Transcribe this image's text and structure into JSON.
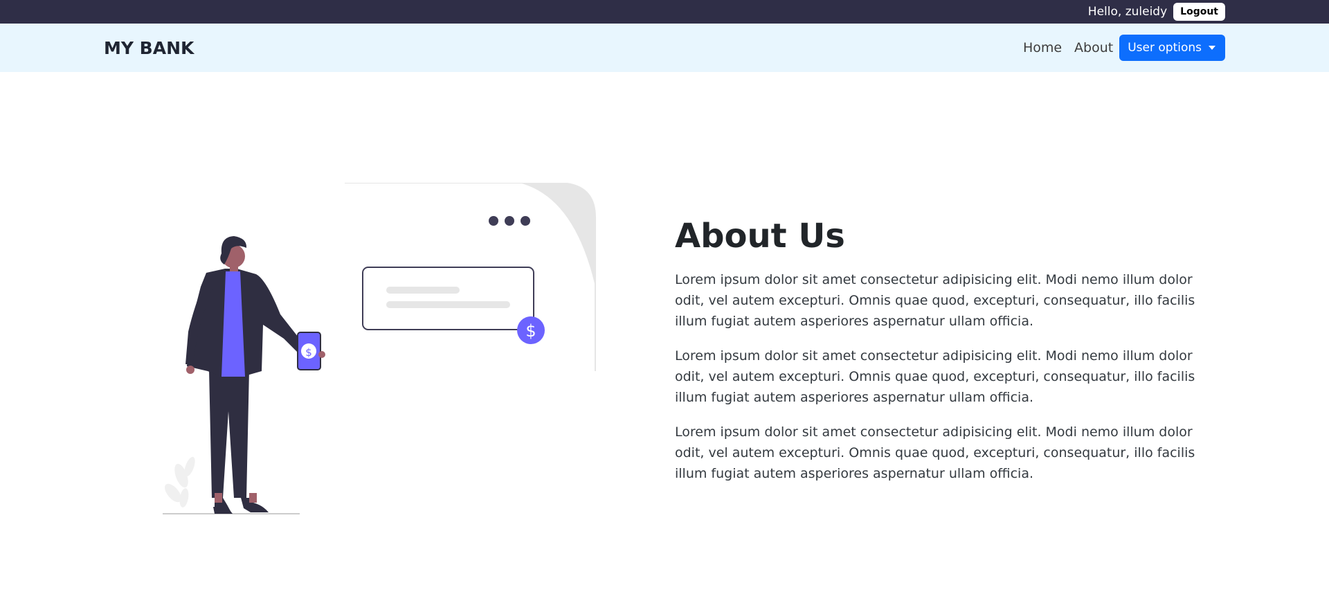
{
  "topbar": {
    "greeting": "Hello, zuleidy",
    "logout_label": "Logout"
  },
  "navbar": {
    "brand": "MY BANK",
    "links": [
      {
        "label": "Home"
      },
      {
        "label": "About"
      }
    ],
    "dropdown_label": "User options"
  },
  "about": {
    "title": "About Us",
    "paragraphs": [
      "Lorem ipsum dolor sit amet consectetur adipisicing elit. Modi nemo illum dolor odit, vel autem excepturi. Omnis quae quod, excepturi, consequatur, illo facilis illum fugiat autem asperiores aspernatur ullam officia.",
      "Lorem ipsum dolor sit amet consectetur adipisicing elit. Modi nemo illum dolor odit, vel autem excepturi. Omnis quae quod, excepturi, consequatur, illo facilis illum fugiat autem asperiores aspernatur ullam officia.",
      "Lorem ipsum dolor sit amet consectetur adipisicing elit. Modi nemo illum dolor odit, vel autem excepturi. Omnis quae quod, excepturi, consequatur, illo facilis illum fugiat autem asperiores aspernatur ullam officia."
    ]
  },
  "illustration": {
    "icon": "dollar-sign",
    "coin_symbol": "$",
    "colors": {
      "accent": "#6c63ff",
      "dark": "#2f2e41",
      "skin": "#a0616a",
      "panel": "#e6e6e6"
    }
  },
  "colors": {
    "topbar_bg": "#2f2e47",
    "navbar_bg": "#e8f6fe",
    "primary": "#0d6efd"
  }
}
